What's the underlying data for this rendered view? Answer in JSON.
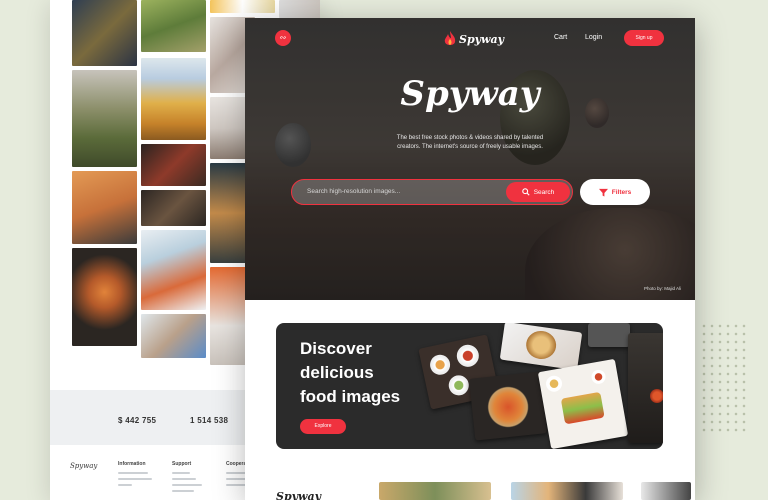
{
  "back_page": {
    "stats": [
      {
        "caption": "",
        "value": "$ 442 755"
      },
      {
        "caption": "",
        "value": "1 514 538"
      }
    ],
    "footer": {
      "brand": "Spyway",
      "columns": [
        "Information",
        "Support",
        "Cooperat"
      ]
    }
  },
  "header": {
    "brand": "Spyway",
    "cart_label": "Cart",
    "login_label": "Login",
    "signup_label": "Sign up"
  },
  "hero": {
    "title": "Spyway",
    "tagline_line1": "The best free stock photos & videos shared by talented",
    "tagline_line2": "creators. The internet's source of freely usable images.",
    "search_placeholder": "Search high-resolution images...",
    "search_label": "Search",
    "filters_label": "Filters",
    "photo_credit": "Photo by: Majid Ali"
  },
  "banner": {
    "title_line1": "Discover",
    "title_line2": "delicious",
    "title_line3": "food images",
    "explore_label": "Explore"
  },
  "section": {
    "title": "Spyway"
  },
  "colors": {
    "accent": "#f0323f",
    "background": "#e6ebdc",
    "hero_dark": "#3c3a39"
  },
  "icons": [
    "rss-icon",
    "flame-logo-icon",
    "search-icon",
    "filter-icon"
  ]
}
